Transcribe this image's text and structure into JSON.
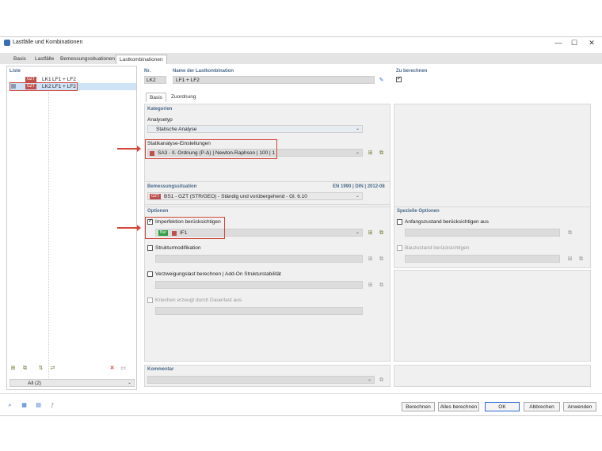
{
  "window": {
    "title": "Lastfälle und Kombinationen",
    "minimize": "—",
    "maximize": "☐",
    "close": "✕"
  },
  "tabs": [
    "Basis",
    "Lastfälle",
    "Bemessungssituationen",
    "Lastkombinationen"
  ],
  "list": {
    "header": "Liste",
    "items": [
      {
        "badge": "GZT",
        "code": "LK1",
        "name": "LF1 + LF2"
      },
      {
        "badge": "GZT",
        "code": "LK2",
        "name": "LF1 + LF2"
      }
    ],
    "filter": "All (2)"
  },
  "header_fields": {
    "nr_label": "Nr.",
    "nr_value": "LK2",
    "name_label": "Name der Lastkombination",
    "name_value": "LF1 + LF2",
    "calc_label": "Zu berechnen"
  },
  "subtabs": [
    "Basis",
    "Zuordnung"
  ],
  "kategorien": {
    "title": "Kategorien",
    "analysetyp_label": "Analysetyp",
    "analysetyp_value": "Statische Analyse",
    "statik_label": "Statikanalyse-Einstellungen",
    "statik_value": "SA3 - II. Ordnung (P-Δ) | Newton-Raphson | 100 | 1"
  },
  "bemessung": {
    "title": "Bemessungssituation",
    "norm": "EN 1990 | DIN | 2012-08",
    "badge": "GZT",
    "value": "BS1 - GZT (STR/GEO) - Ständig und vorübergehend - Gl. 6.10"
  },
  "optionen": {
    "title": "Optionen",
    "imperfection_label": "Imperfektion berücksichtigen",
    "imperfection_badge": "Nur",
    "imperfection_value": "IF1",
    "struktur_label": "Strukturmodifikation",
    "verzweigung_label": "Verzweigungslast berechnen | Add-On Strukturstabilität",
    "kriechen_label": "Kriechen erzeugt durch Dauerlast aus"
  },
  "spezielle": {
    "title": "Spezielle Optionen",
    "anfang_label": "Anfangszustand berücksichtigen aus",
    "bau_label": "Bauzustand berücksichtigen"
  },
  "kommentar": {
    "title": "Kommentar"
  },
  "buttons": {
    "berechnen": "Berechnen",
    "alles": "Alles berechnen",
    "ok": "OK",
    "abbrechen": "Abbrechen",
    "anwenden": "Anwenden"
  },
  "colors": {
    "accent": "#2a6ad0",
    "red": "#d2453a",
    "badge": "#c0504d",
    "green": "#2e9e45"
  }
}
